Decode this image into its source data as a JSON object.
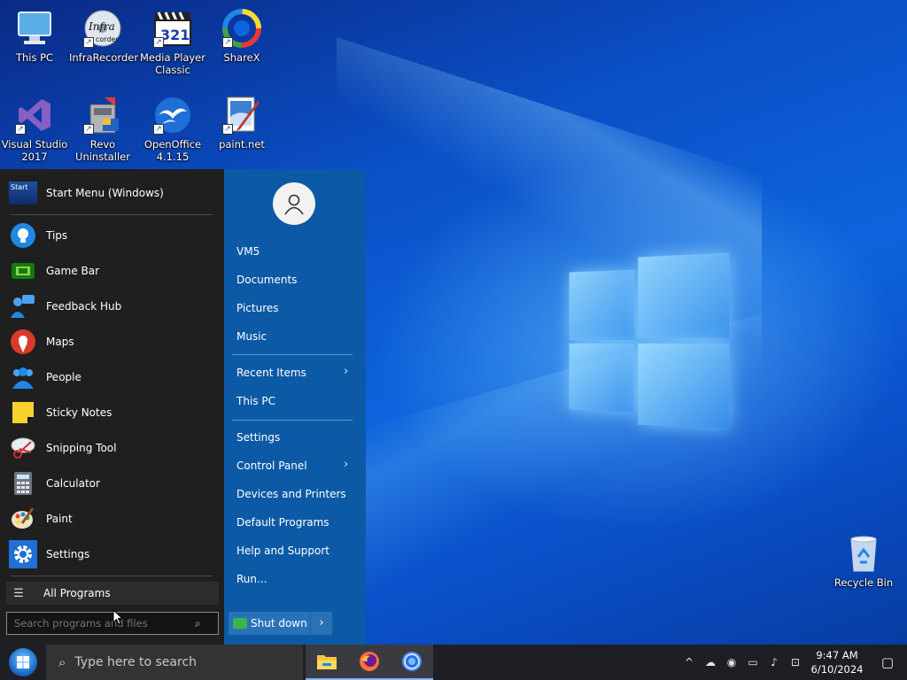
{
  "desktop": {
    "icons": [
      {
        "label": "This PC"
      },
      {
        "label": "InfraRecorder"
      },
      {
        "label": "Media Player Classic"
      },
      {
        "label": "ShareX"
      },
      {
        "label": "Visual Studio 2017"
      },
      {
        "label": "Revo Uninstaller"
      },
      {
        "label": "OpenOffice 4.1.15"
      },
      {
        "label": "paint.net"
      },
      {
        "label": "Recycle Bin"
      }
    ],
    "icon_text": {
      "infra_logo": "Infra",
      "infra_sub": "corder",
      "mpc_digits": "321"
    }
  },
  "start_menu": {
    "header": {
      "logo_text": "Start",
      "label": "Start Menu (Windows)"
    },
    "programs": [
      {
        "name": "Tips"
      },
      {
        "name": "Game Bar"
      },
      {
        "name": "Feedback Hub"
      },
      {
        "name": "Maps"
      },
      {
        "name": "People"
      },
      {
        "name": "Sticky Notes"
      },
      {
        "name": "Snipping Tool"
      },
      {
        "name": "Calculator"
      },
      {
        "name": "Paint"
      },
      {
        "name": "Settings"
      }
    ],
    "all_programs": "All Programs",
    "search_placeholder": "Search programs and files",
    "right_links": [
      {
        "label": "VM5"
      },
      {
        "label": "Documents"
      },
      {
        "label": "Pictures"
      },
      {
        "label": "Music"
      },
      {
        "label": "Recent Items"
      },
      {
        "label": "This PC"
      },
      {
        "label": "Settings"
      },
      {
        "label": "Control Panel"
      },
      {
        "label": "Devices and Printers"
      },
      {
        "label": "Default Programs"
      },
      {
        "label": "Help and Support"
      },
      {
        "label": "Run..."
      }
    ],
    "shutdown": "Shut down"
  },
  "taskbar": {
    "search_placeholder": "Type here to search",
    "time": "9:47 AM",
    "date": "6/10/2024"
  },
  "colors": {
    "menu_left": "#1f1f1f",
    "menu_right": "#0c5aa6",
    "taskbar": "#1e1f24"
  }
}
